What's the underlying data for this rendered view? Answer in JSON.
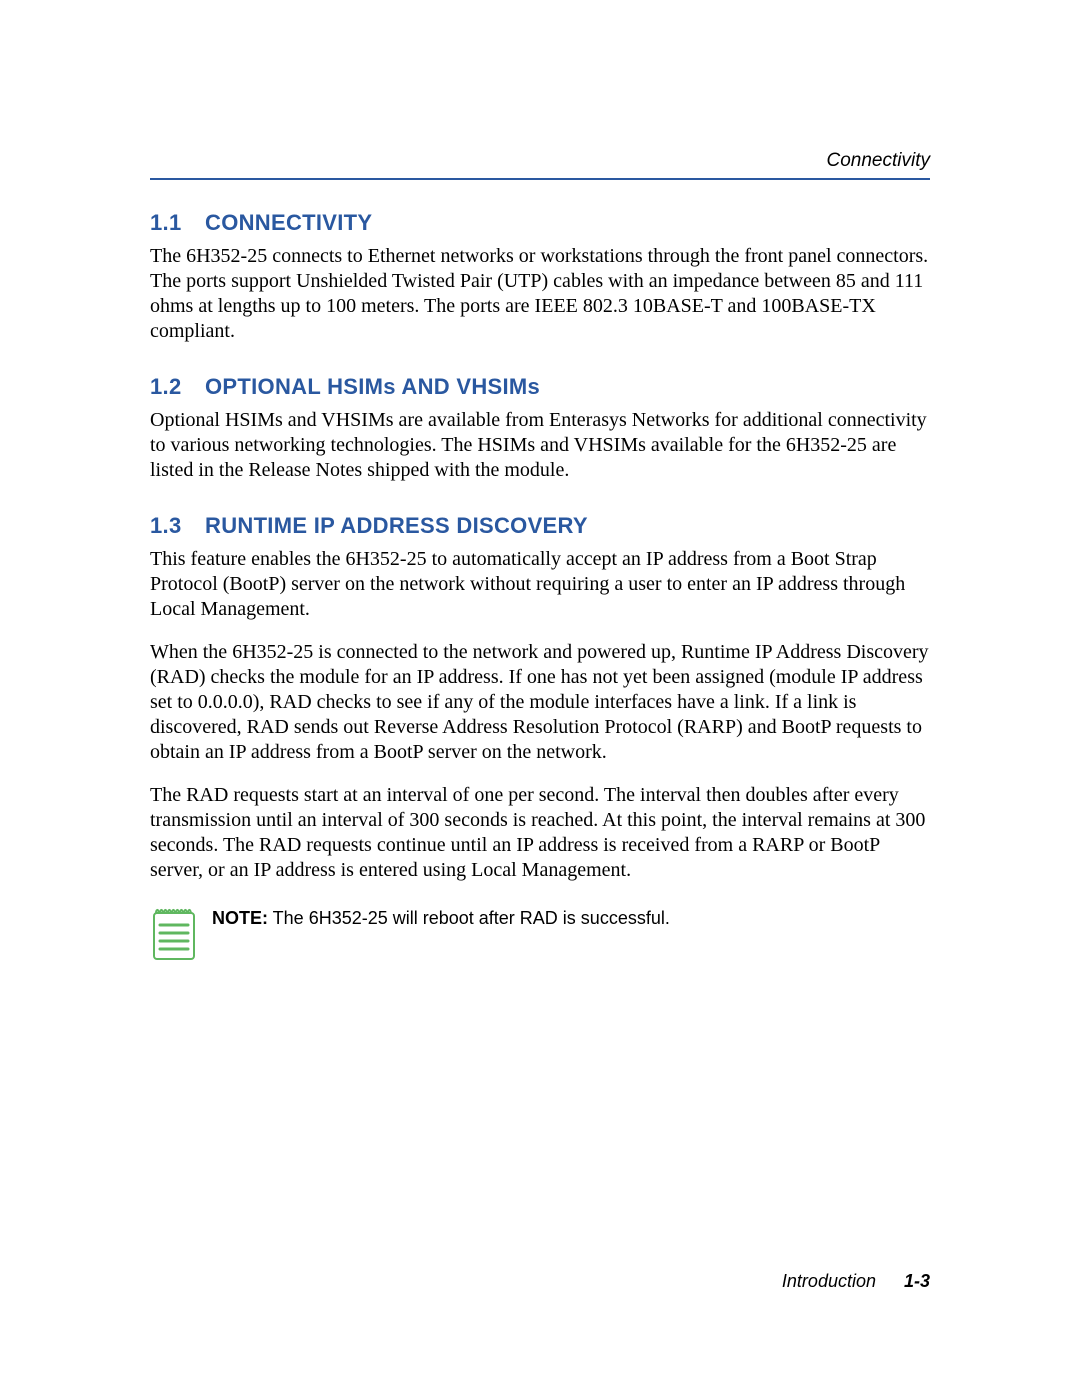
{
  "header": {
    "running_head": "Connectivity"
  },
  "sections": {
    "s1": {
      "num": "1.1",
      "title": "CONNECTIVITY",
      "p1": "The 6H352-25 connects to Ethernet networks or workstations through the front panel connectors. The ports support Unshielded Twisted Pair (UTP) cables with an impedance between 85 and 111 ohms at lengths up to 100 meters. The ports are IEEE 802.3 10BASE-T and 100BASE-TX compliant."
    },
    "s2": {
      "num": "1.2",
      "title": "OPTIONAL HSIMs AND VHSIMs",
      "p1": "Optional HSIMs and VHSIMs are available from Enterasys Networks for additional connectivity to various networking technologies. The HSIMs and VHSIMs available for the 6H352-25 are listed in the Release Notes shipped with the module."
    },
    "s3": {
      "num": "1.3",
      "title": "RUNTIME IP ADDRESS DISCOVERY",
      "p1": "This feature enables the 6H352-25 to automatically accept an IP address from a Boot Strap Protocol (BootP) server on the network without requiring a user to enter an IP address through Local Management.",
      "p2": "When the 6H352-25 is connected to the network and powered up, Runtime IP Address Discovery (RAD) checks the module for an IP address. If one has not yet been assigned (module IP address set to 0.0.0.0), RAD checks to see if any of the module interfaces have a link. If a link is discovered, RAD sends out Reverse Address Resolution Protocol (RARP) and BootP requests to obtain an IP address from a BootP server on the network.",
      "p3": "The RAD requests start at an interval of one per second. The interval then doubles after every transmission until an interval of 300 seconds is reached. At this point, the interval remains at 300 seconds. The RAD requests continue until an IP address is received from a RARP or BootP server, or an IP address is entered using Local Management."
    }
  },
  "note": {
    "label": "NOTE:",
    "text": " The 6H352-25 will reboot after RAD is successful."
  },
  "footer": {
    "chapter": "Introduction",
    "page": "1-3"
  }
}
